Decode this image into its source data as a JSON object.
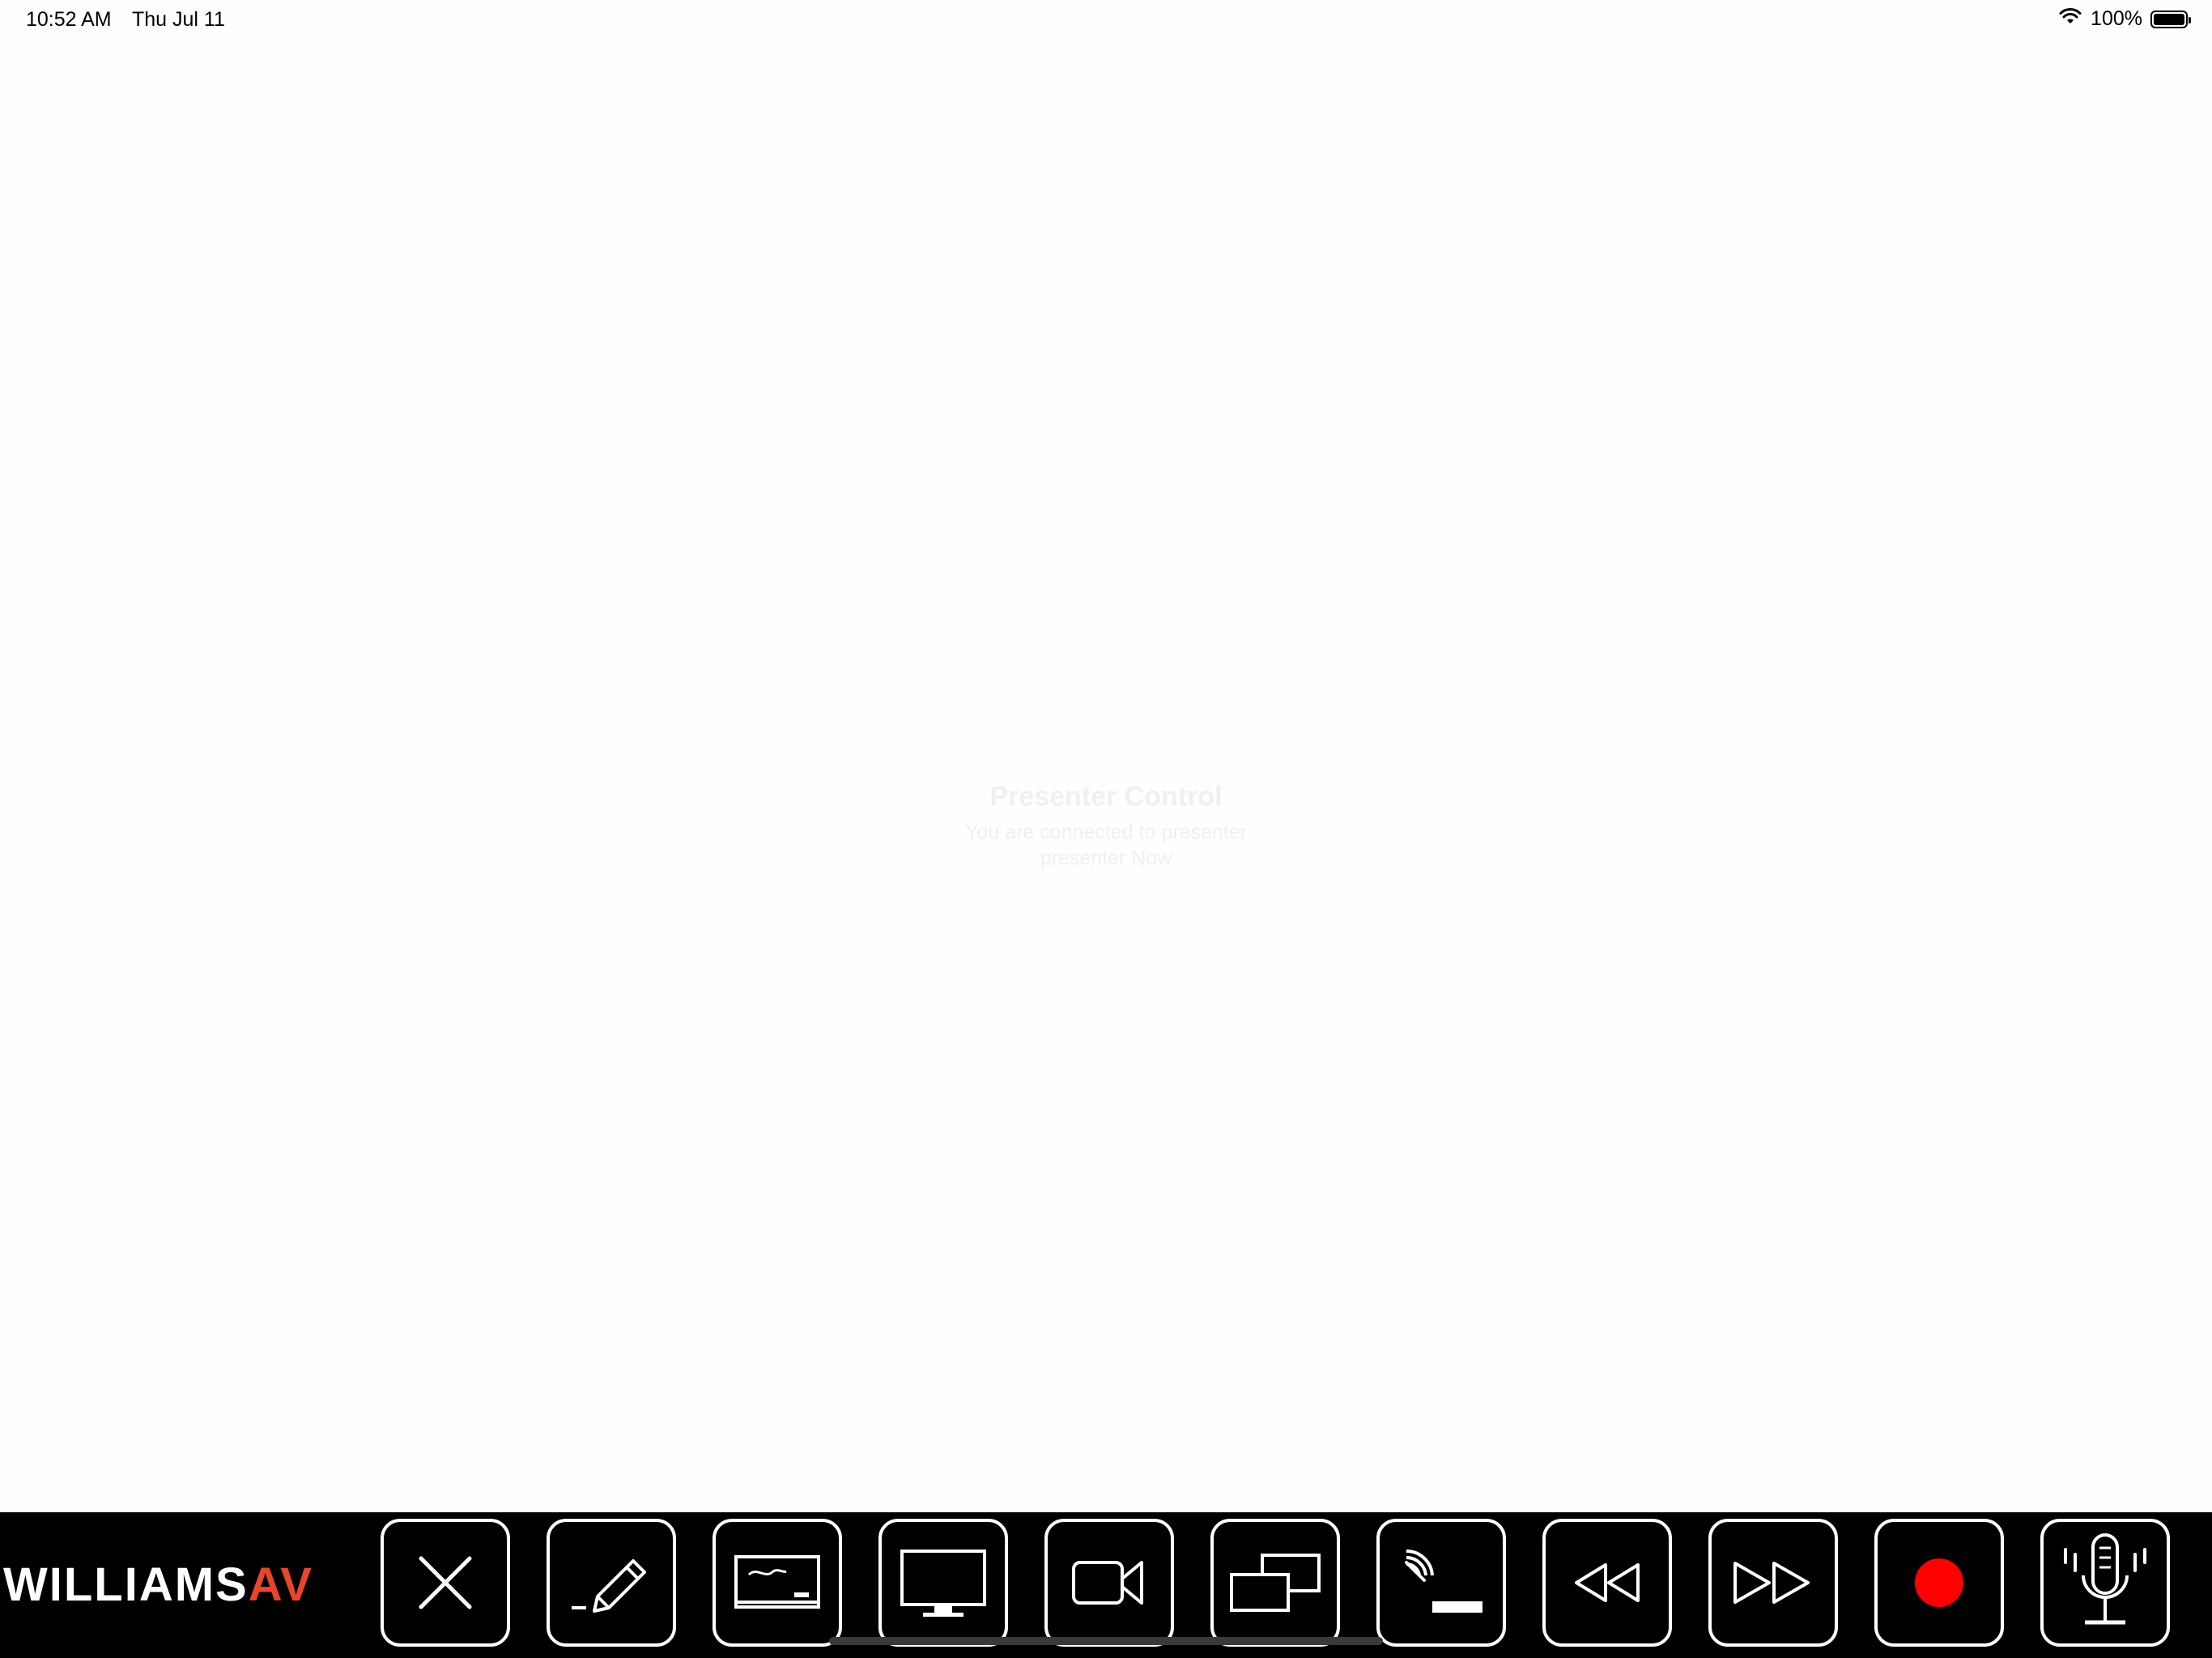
{
  "status_bar": {
    "time": "10:52 AM",
    "date": "Thu Jul 11",
    "battery_text": "100%",
    "wifi_icon": "wifi-icon",
    "battery_level": 1.0
  },
  "main": {
    "title": "Presenter Control",
    "subtitle_line1": "You are connected to presenter",
    "subtitle_line2": "presenter Now"
  },
  "logo": {
    "part1": "WILLIAMS",
    "part2": "AV",
    "accent_color": "#e8452c"
  },
  "toolbar": {
    "buttons": [
      {
        "icon": "close-icon"
      },
      {
        "icon": "pencil-icon"
      },
      {
        "icon": "whiteboard-icon"
      },
      {
        "icon": "monitor-icon"
      },
      {
        "icon": "video-camera-icon"
      },
      {
        "icon": "dual-screen-icon"
      },
      {
        "icon": "signal-level-icon"
      },
      {
        "icon": "rewind-icon"
      },
      {
        "icon": "fast-forward-icon"
      },
      {
        "icon": "record-icon",
        "color": "#ff0000"
      },
      {
        "icon": "microphone-icon"
      }
    ]
  }
}
